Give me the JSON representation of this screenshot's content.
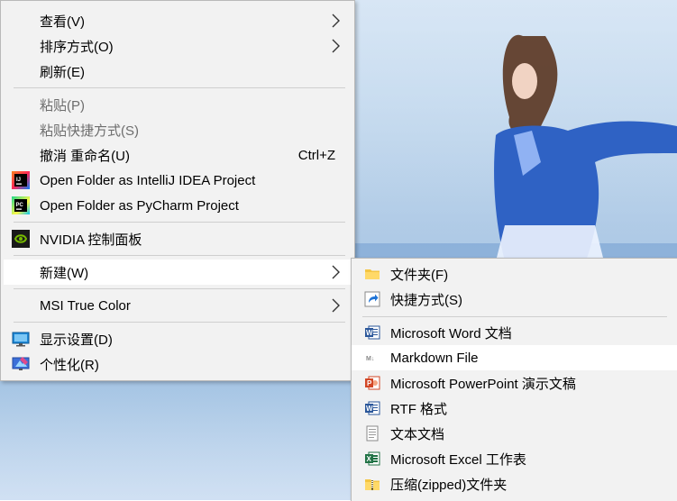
{
  "main_menu": {
    "items": [
      {
        "label": "查看(V)"
      },
      {
        "label": "排序方式(O)"
      },
      {
        "label": "刷新(E)"
      },
      {
        "label": "粘贴(P)"
      },
      {
        "label": "粘贴快捷方式(S)"
      },
      {
        "label": "撤消 重命名(U)",
        "shortcut": "Ctrl+Z"
      },
      {
        "label": "Open Folder as IntelliJ IDEA Project",
        "icon": "intellij-icon"
      },
      {
        "label": "Open Folder as PyCharm Project",
        "icon": "pycharm-icon"
      },
      {
        "label": "NVIDIA 控制面板",
        "icon": "nvidia-icon"
      },
      {
        "label": "新建(W)"
      },
      {
        "label": "MSI True Color"
      },
      {
        "label": "显示设置(D)",
        "icon": "display-icon"
      },
      {
        "label": "个性化(R)",
        "icon": "personalize-icon"
      }
    ]
  },
  "new_submenu": {
    "items": [
      {
        "label": "文件夹(F)",
        "icon": "folder-icon"
      },
      {
        "label": "快捷方式(S)",
        "icon": "shortcut-icon"
      },
      {
        "label": "Microsoft Word 文档",
        "icon": "word-icon"
      },
      {
        "label": "Markdown File",
        "icon": "markdown-icon"
      },
      {
        "label": "Microsoft PowerPoint 演示文稿",
        "icon": "powerpoint-icon"
      },
      {
        "label": "RTF 格式",
        "icon": "rtf-icon"
      },
      {
        "label": "文本文档",
        "icon": "text-doc-icon"
      },
      {
        "label": "Microsoft Excel 工作表",
        "icon": "excel-icon"
      },
      {
        "label": "压缩(zipped)文件夹",
        "icon": "zip-folder-icon"
      }
    ]
  },
  "colors": {
    "menu_bg": "#f2f2f2",
    "hover_bg": "#ffffff",
    "disabled_text": "#6d6d6d",
    "word_blue": "#2b579a",
    "ppt_orange": "#d24726",
    "excel_green": "#217346",
    "nvidia_green": "#76b900"
  }
}
